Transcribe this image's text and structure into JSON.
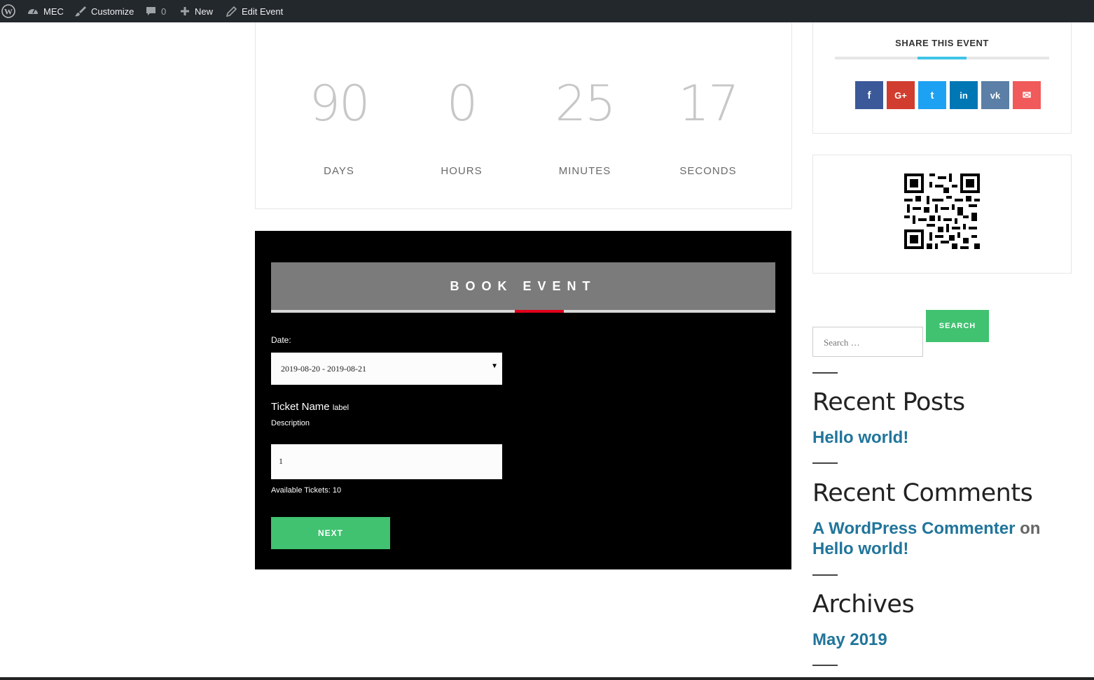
{
  "admin_bar": {
    "site": "MEC",
    "customize": "Customize",
    "comments_count": "0",
    "new": "New",
    "edit": "Edit Event"
  },
  "countdown": {
    "units": [
      {
        "value": "90",
        "label": "DAYS"
      },
      {
        "value": "0",
        "label": "HOURS"
      },
      {
        "value": "25",
        "label": "MINUTES"
      },
      {
        "value": "17",
        "label": "SECONDS"
      }
    ]
  },
  "booking": {
    "title": "BOOK EVENT",
    "date_label": "Date:",
    "date_value": "2019-08-20 - 2019-08-21",
    "ticket_name": "Ticket Name",
    "ticket_badge": "label",
    "ticket_description": "Description",
    "quantity": "1",
    "available": "Available Tickets: 10",
    "next_label": "NEXT",
    "colors": {
      "header": "#7b7b7b",
      "accent": "#e0001c",
      "button": "#40c270"
    }
  },
  "sidebar": {
    "share_title": "SHARE THIS EVENT",
    "share_icons": [
      {
        "icon": "facebook-icon",
        "glyph": "f",
        "color": "#3b5998"
      },
      {
        "icon": "google-plus-icon",
        "glyph": "G+",
        "color": "#d13d2f"
      },
      {
        "icon": "twitter-icon",
        "glyph": "t",
        "color": "#1da1f2"
      },
      {
        "icon": "linkedin-icon",
        "glyph": "in",
        "color": "#0077b5"
      },
      {
        "icon": "vk-icon",
        "glyph": "vk",
        "color": "#5b7fa6"
      },
      {
        "icon": "email-icon",
        "glyph": "✉",
        "color": "#f05a5b"
      }
    ],
    "search_placeholder": "Search …",
    "search_button": "SEARCH",
    "recent_posts_title": "Recent Posts",
    "recent_post": "Hello world!",
    "recent_comments_title": "Recent Comments",
    "comment_author": "A WordPress Commenter",
    "comment_on": "on",
    "comment_post": "Hello world!",
    "archives_title": "Archives",
    "archive_item": "May 2019"
  }
}
